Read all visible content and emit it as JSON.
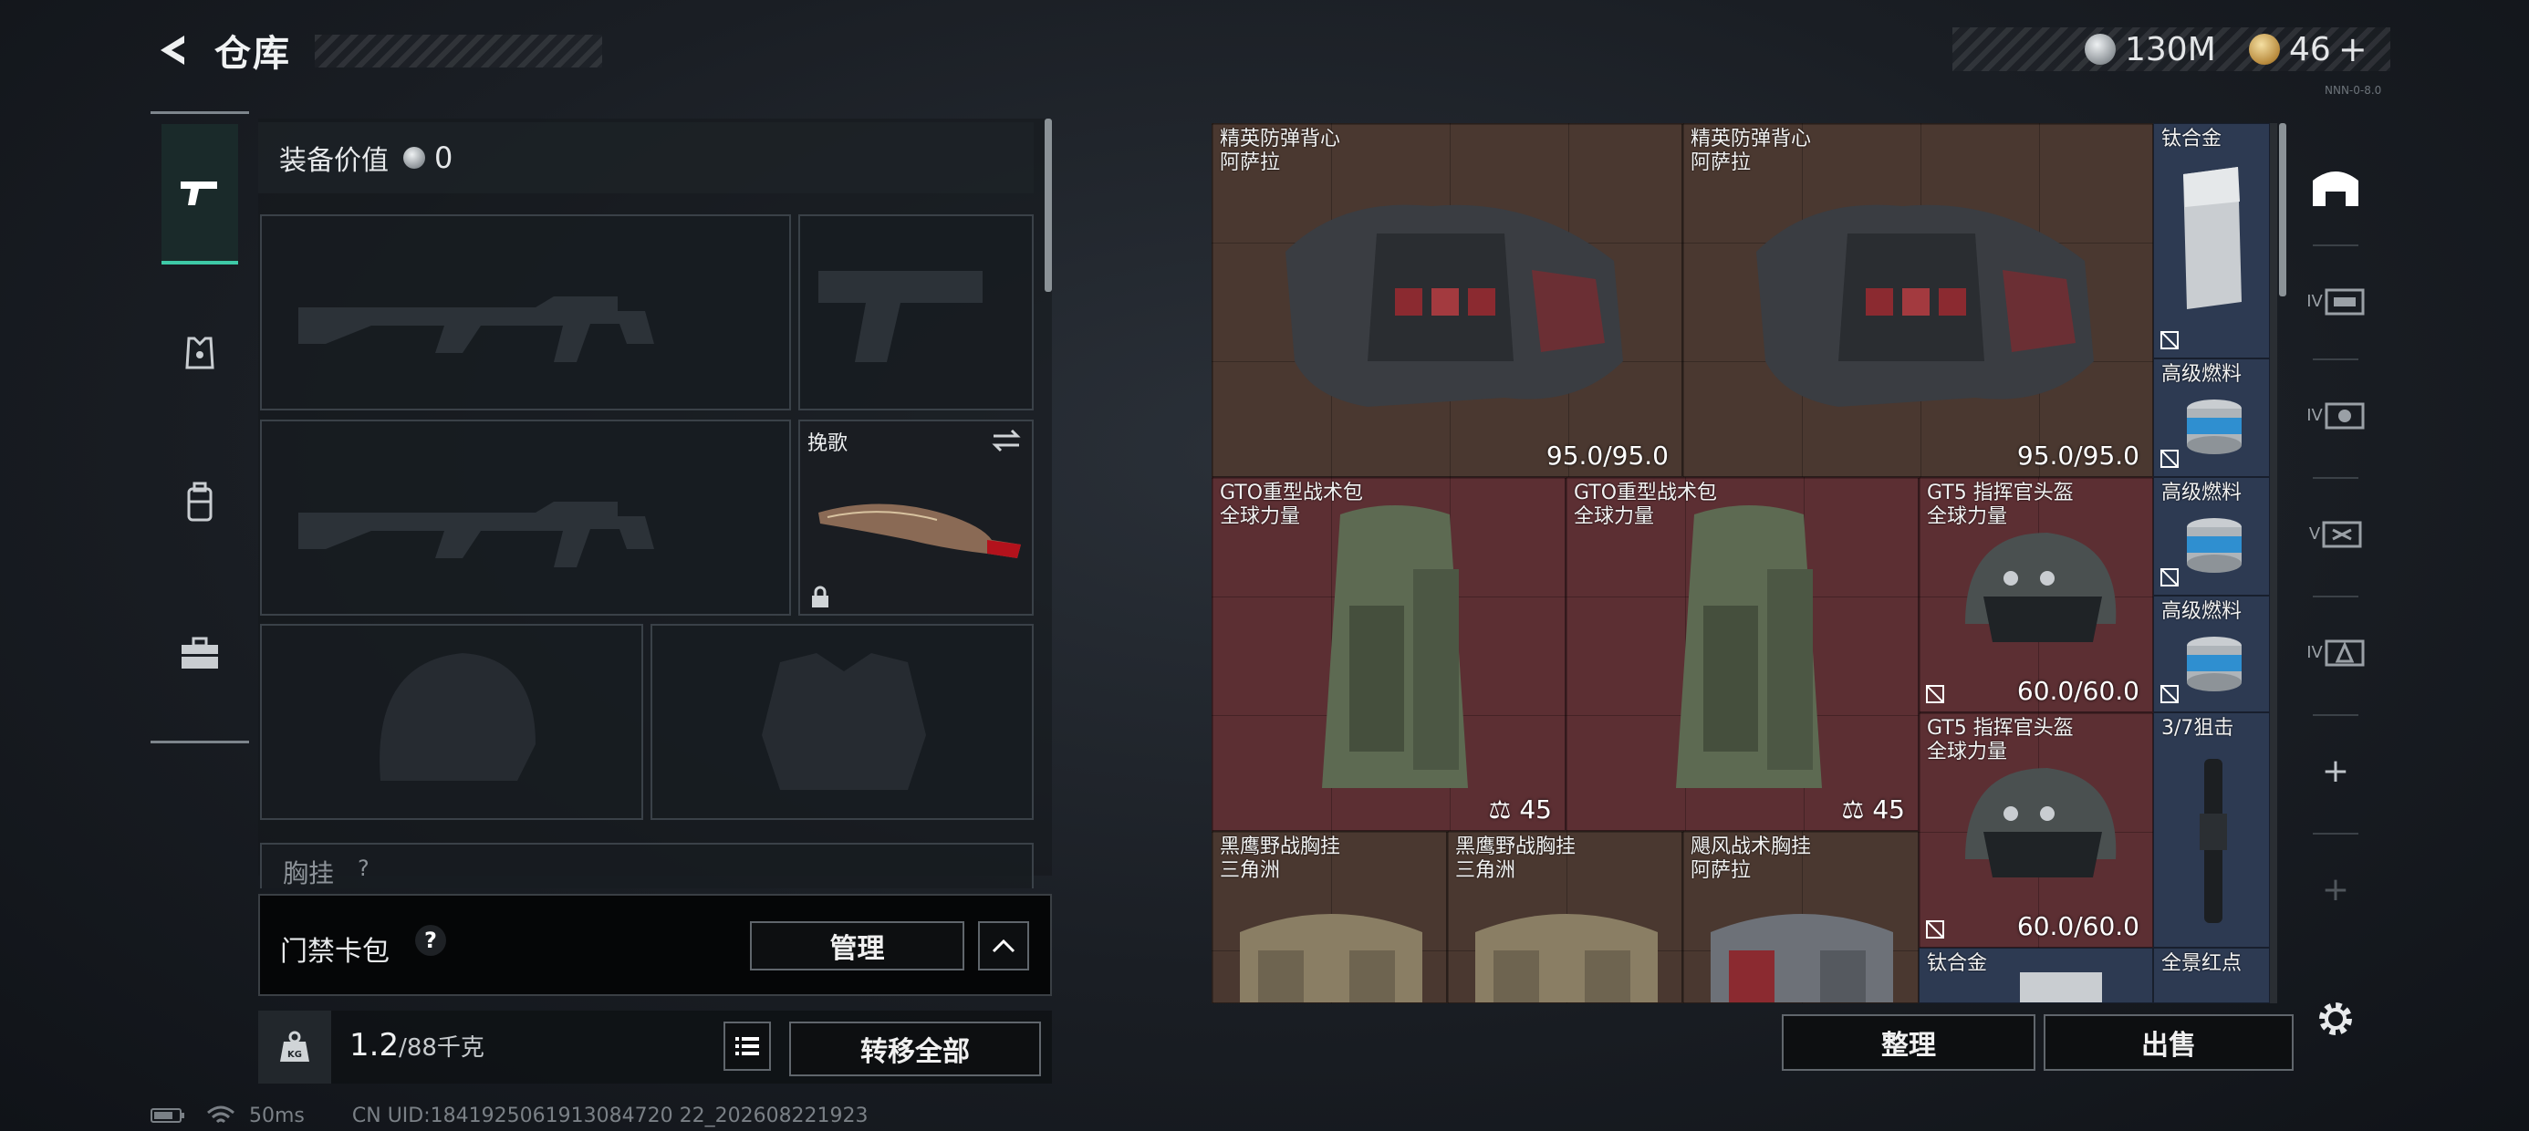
{
  "header": {
    "title": "仓库",
    "currency_silver": "130M",
    "currency_gold": "46",
    "gold_add": "+",
    "build_no": "NNN-0-8.0",
    "silver_color": "#b9bec3",
    "gold_color": "#c9a65a"
  },
  "left_nav": {
    "items": [
      "weapons-icon",
      "armor-icon",
      "backpack-icon",
      "toolbox-icon"
    ],
    "active_index": 0,
    "accent_color": "#3ec9a7"
  },
  "loadout": {
    "equip_value_label": "装备价值",
    "equip_value": "0",
    "melee_name": "挽歌",
    "chest_rig_label": "胸挂",
    "chest_rig_help": "?"
  },
  "keycard": {
    "label": "门禁卡包",
    "help": "?",
    "manage_label": "管理"
  },
  "weight": {
    "current": "1.2",
    "max": "/88千克",
    "kg_icon_text": "KG",
    "transfer_all_label": "转移全部"
  },
  "stash": {
    "items": [
      {
        "name": "精英防弹背心",
        "sub": "阿萨拉",
        "value": "95.0/95.0"
      },
      {
        "name": "精英防弹背心",
        "sub": "阿萨拉",
        "value": "95.0/95.0"
      },
      {
        "name": "钛合金",
        "sub": "",
        "value": ""
      },
      {
        "name": "高级燃料",
        "sub": "",
        "value": ""
      },
      {
        "name": "高级燃料",
        "sub": "",
        "value": ""
      },
      {
        "name": "高级燃料",
        "sub": "",
        "value": ""
      },
      {
        "name": "GTO重型战术包",
        "sub": "全球力量",
        "value": "45"
      },
      {
        "name": "GTO重型战术包",
        "sub": "全球力量",
        "value": "45"
      },
      {
        "name": "GT5 指挥官头盔",
        "sub": "全球力量",
        "value": "60.0/60.0"
      },
      {
        "name": "GT5 指挥官头盔",
        "sub": "全球力量",
        "value": "60.0/60.0"
      },
      {
        "name": "3/7狙击",
        "sub": "",
        "value": ""
      },
      {
        "name": "黑鹰野战胸挂",
        "sub": "三角洲",
        "value": ""
      },
      {
        "name": "黑鹰野战胸挂",
        "sub": "三角洲",
        "value": ""
      },
      {
        "name": "飓风战术胸挂",
        "sub": "阿萨拉",
        "value": ""
      },
      {
        "name": "钛合金",
        "sub": "",
        "value": ""
      },
      {
        "name": "全景红点",
        "sub": "",
        "value": ""
      }
    ],
    "sort_label": "整理",
    "sell_label": "出售",
    "rarity_gold": "#5a4236",
    "rarity_red": "#5c2f33",
    "rarity_blue": "#2d3a52"
  },
  "right_nav": {
    "tabs": [
      "stash-home-icon",
      "stash-iv-1-icon",
      "stash-iv-2-icon",
      "stash-v-icon",
      "stash-iv-3-icon",
      "add-stash-icon",
      "add-stash-disabled-icon",
      "settings-icon"
    ],
    "tab_labels": [
      "",
      "IV",
      "IV",
      "V",
      "IV",
      "+",
      "+",
      ""
    ]
  },
  "status": {
    "ping": "50ms",
    "uid": "CN UID:1841925061913084720 22_202608221923"
  }
}
